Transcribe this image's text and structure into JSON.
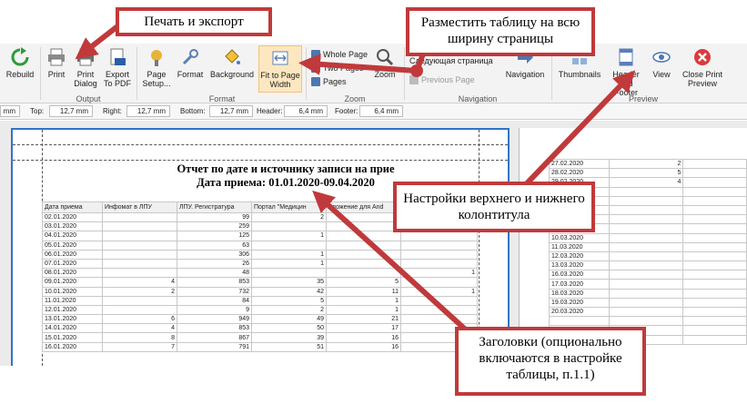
{
  "ribbon": {
    "buttons": {
      "rebuild": "Rebuild",
      "print": "Print",
      "print_dialog": "Print Dialog",
      "export_pdf": "Export To PDF",
      "page_setup": "Page Setup...",
      "format": "Format",
      "background": "Background",
      "fit_to_page_width": "Fit to Page Width",
      "whole_page": "Whole Page",
      "two_pages": "Two Pages",
      "pages": "Pages",
      "zoom": "Zoom",
      "last_page": "Следующая страница",
      "previous_page": "Previous Page",
      "navigation": "Navigation",
      "thumbnails": "Thumbnails",
      "header_footer": "Header and Footer",
      "view": "View",
      "close_print_preview": "Close Print Preview"
    },
    "groups": {
      "output": "Output",
      "format": "Format",
      "zoom": "Zoom",
      "navigation": "Navigation",
      "preview": "Preview"
    }
  },
  "margins": {
    "left_value": "mm",
    "top_label": "Top:",
    "top_value": "12,7 mm",
    "right_label": "Right:",
    "right_value": "12,7 mm",
    "bottom_label": "Bottom:",
    "bottom_value": "12,7 mm",
    "header_label": "Header:",
    "header_value": "6,4 mm",
    "footer_label": "Footer:",
    "footer_value": "6,4 mm"
  },
  "report": {
    "title": "Отчет по дате и источнику записи на прие",
    "subtitle": "Дата приема: 01.01.2020-09.04.2020",
    "columns": [
      "Дата приема",
      "Инфомат в ЛПУ",
      "ЛПУ. Регистратура",
      "Портал \"Медицин",
      "иложение для And",
      ""
    ],
    "rows": [
      [
        "02.01.2020",
        "",
        "99",
        "2",
        "",
        ""
      ],
      [
        "03.01.2020",
        "",
        "259",
        "",
        "",
        ""
      ],
      [
        "04.01.2020",
        "",
        "125",
        "1",
        "",
        ""
      ],
      [
        "05.01.2020",
        "",
        "63",
        "",
        "",
        ""
      ],
      [
        "06.01.2020",
        "",
        "306",
        "1",
        "",
        ""
      ],
      [
        "07.01.2020",
        "",
        "26",
        "1",
        "",
        ""
      ],
      [
        "08.01.2020",
        "",
        "48",
        "",
        "",
        "1"
      ],
      [
        "09.01.2020",
        "4",
        "853",
        "35",
        "5",
        ""
      ],
      [
        "10.01.2020",
        "2",
        "732",
        "42",
        "11",
        "1"
      ],
      [
        "11.01.2020",
        "",
        "84",
        "5",
        "1",
        ""
      ],
      [
        "12.01.2020",
        "",
        "9",
        "2",
        "1",
        ""
      ],
      [
        "13.01.2020",
        "6",
        "949",
        "49",
        "21",
        ""
      ],
      [
        "14.01.2020",
        "4",
        "853",
        "50",
        "17",
        ""
      ],
      [
        "15.01.2020",
        "8",
        "867",
        "39",
        "16",
        ""
      ],
      [
        "16.01.2020",
        "7",
        "791",
        "51",
        "16",
        ""
      ]
    ]
  },
  "page2": {
    "rows": [
      [
        "27.02.2020",
        "2"
      ],
      [
        "28.02.2020",
        "5"
      ],
      [
        "29.02.2020",
        "4"
      ],
      [
        "",
        ""
      ],
      [
        "",
        ""
      ],
      [
        "",
        ""
      ],
      [
        "",
        ""
      ],
      [
        "",
        ""
      ],
      [
        "10.03.2020",
        ""
      ],
      [
        "11.03.2020",
        ""
      ],
      [
        "12.03.2020",
        ""
      ],
      [
        "13.03.2020",
        ""
      ],
      [
        "16.03.2020",
        ""
      ],
      [
        "17.03.2020",
        ""
      ],
      [
        "18.03.2020",
        ""
      ],
      [
        "19.03.2020",
        ""
      ],
      [
        "20.03.2020",
        ""
      ],
      [
        "",
        ""
      ],
      [
        "",
        ""
      ],
      [
        "",
        ""
      ]
    ]
  },
  "callouts": {
    "print_export": "Печать и экспорт",
    "fit_table": "Разместить таблицу на всю ширину страницы",
    "header_footer": "Настройки верхнего и нижнего колонтитула",
    "headings": "Заголовки (опционально включаются в настройке таблицы, п.1.1)"
  },
  "colors": {
    "callout_border": "#c0393b",
    "arrow": "#c0393b",
    "highlight": "#fde7c0",
    "page_border": "#2f74c6"
  }
}
